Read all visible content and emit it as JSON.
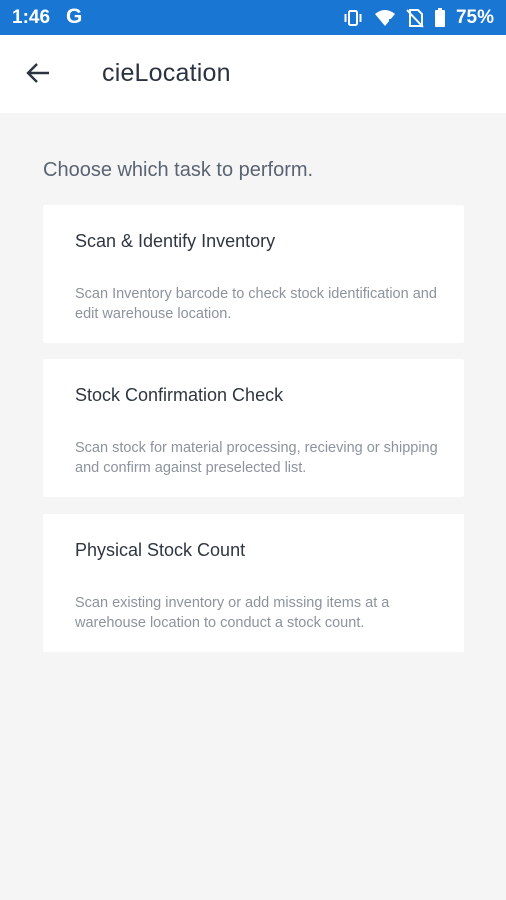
{
  "status_bar": {
    "time": "1:46",
    "google_letter": "G",
    "battery": "75%",
    "icons": [
      "vibrate-icon",
      "wifi-icon",
      "no-sim-icon",
      "battery-icon"
    ],
    "background": "#1976d2"
  },
  "app_bar": {
    "back_icon": "arrow-left-icon",
    "title": "cieLocation"
  },
  "main": {
    "prompt": "Choose which task to perform.",
    "tasks": [
      {
        "title": "Scan & Identify Inventory",
        "description": "Scan Inventory barcode to check stock identification and edit warehouse location."
      },
      {
        "title": "Stock Confirmation Check",
        "description": "Scan stock for material processing, recieving or shipping and confirm against preselected list."
      },
      {
        "title": "Physical Stock Count",
        "description": "Scan existing inventory or add missing items at a warehouse location to conduct a stock count."
      }
    ]
  }
}
